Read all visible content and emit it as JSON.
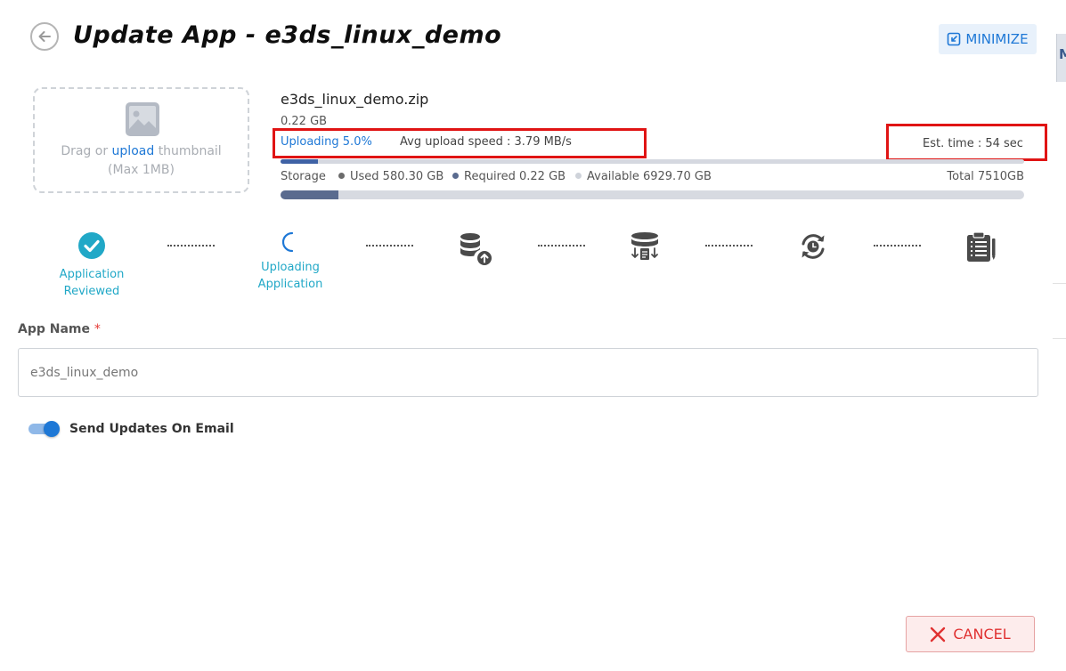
{
  "header": {
    "title": "Update App - e3ds_linux_demo",
    "minimize_label": "MINIMIZE",
    "back_icon": "back-arrow-icon"
  },
  "thumbnail": {
    "prefix": "Drag or",
    "link": "upload",
    "suffix": "thumbnail",
    "limit": "(Max 1MB)"
  },
  "upload": {
    "file_name": "e3ds_linux_demo.zip",
    "file_size": "0.22 GB",
    "status": "Uploading 5.0%",
    "progress_fraction": 0.05,
    "avg_speed": "Avg upload speed : 3.79 MB/s",
    "est_time": "Est. time : 54 sec"
  },
  "storage": {
    "label": "Storage",
    "used": "Used 580.30 GB",
    "required": "Required 0.22 GB",
    "available": "Available 6929.70 GB",
    "total": "Total 7510GB",
    "used_fraction": 0.0773,
    "colors": {
      "used": "#6b6b6b",
      "required": "#5a6b8f",
      "available": "#cfd3da"
    }
  },
  "steps": [
    {
      "line1": "Application",
      "line2": "Reviewed",
      "state": "done",
      "icon": "check-circle-icon"
    },
    {
      "line1": "Uploading",
      "line2": "Application",
      "state": "active",
      "icon": "spinner-icon"
    },
    {
      "state": "pending",
      "icon": "database-upload-icon"
    },
    {
      "state": "pending",
      "icon": "database-transfer-icon"
    },
    {
      "state": "pending",
      "icon": "sync-clock-icon"
    },
    {
      "state": "pending",
      "icon": "clipboard-list-icon"
    }
  ],
  "form": {
    "app_name_label": "App Name",
    "required_mark": "*",
    "app_name_value": "e3ds_linux_demo"
  },
  "notify": {
    "label": "Send Updates On Email",
    "enabled": true
  },
  "footer": {
    "cancel_label": "CANCEL"
  },
  "colors": {
    "accent": "#1e78d6",
    "step_done": "#21a8c7",
    "cancel": "#e03131",
    "highlight": "#e01414"
  }
}
